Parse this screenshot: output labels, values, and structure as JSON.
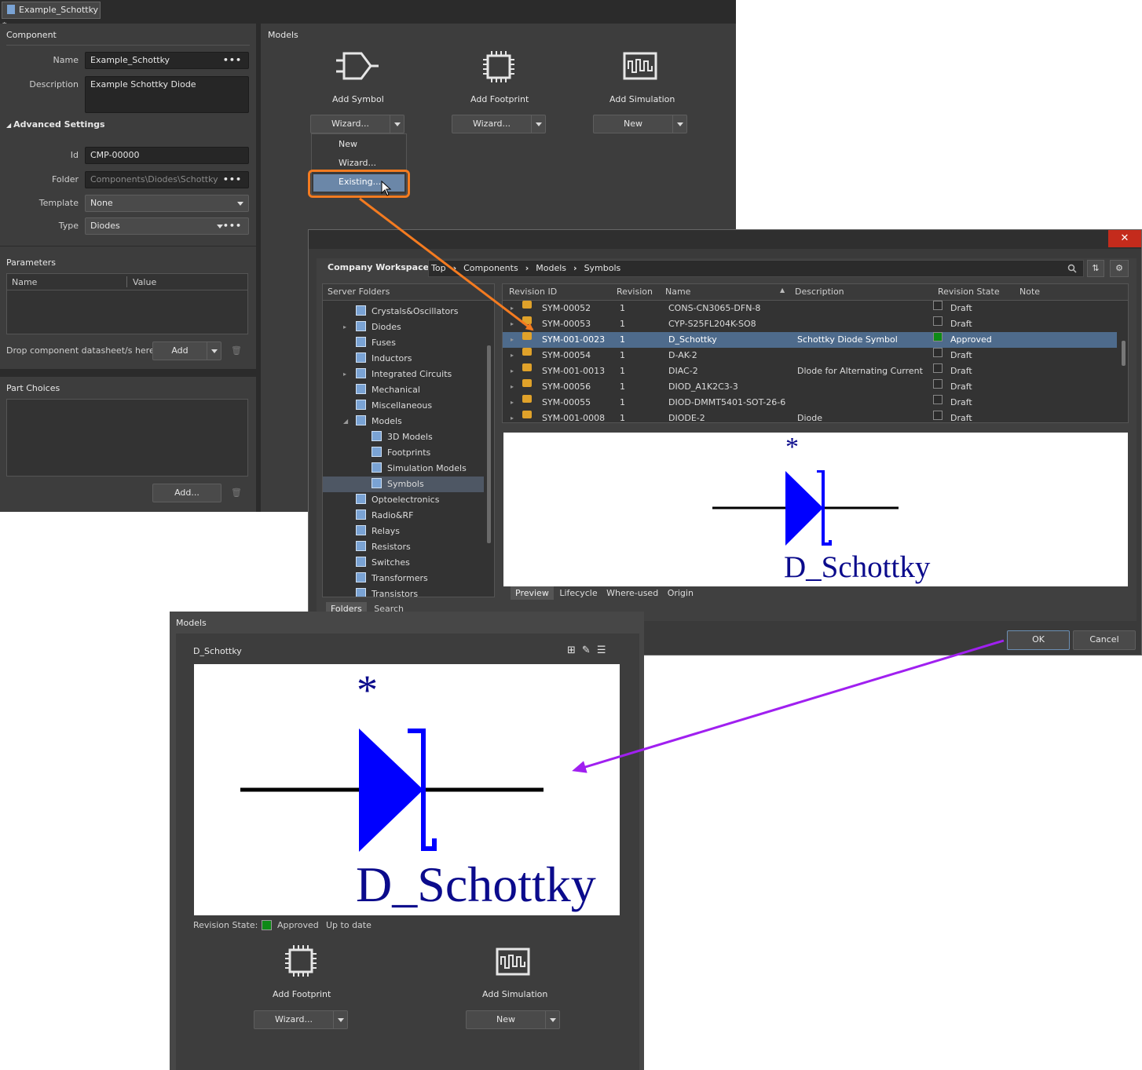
{
  "tab": {
    "title": "Example_Schottky *"
  },
  "component": {
    "section_title": "Component",
    "name_label": "Name",
    "name_value": "Example_Schottky",
    "description_label": "Description",
    "description_value": "Example Schottky Diode",
    "advanced_label": "Advanced Settings",
    "id_label": "Id",
    "id_value": "CMP-00000",
    "folder_label": "Folder",
    "folder_value": "Components\\Diodes\\Schottky",
    "template_label": "Template",
    "template_value": "None",
    "type_label": "Type",
    "type_value": "Diodes"
  },
  "parameters": {
    "section_title": "Parameters",
    "col_name": "Name",
    "col_value": "Value",
    "drop_text": "Drop component datasheet/s here",
    "add_label": "Add"
  },
  "part_choices": {
    "section_title": "Part Choices",
    "add_label": "Add..."
  },
  "models_top": {
    "section_title": "Models",
    "add_symbol": "Add Symbol",
    "add_footprint": "Add Footprint",
    "add_simulation": "Add Simulation",
    "symbol_btn": "Wizard...",
    "footprint_btn": "Wizard...",
    "simulation_btn": "New",
    "menu_items": [
      "New",
      "Wizard...",
      "Existing..."
    ]
  },
  "dialog": {
    "close_glyph": "✕",
    "workspace": "Company Workspace",
    "breadcrumb": [
      "Top",
      "Components",
      "Models",
      "Symbols"
    ],
    "folders_title": "Server Folders",
    "folders": [
      {
        "label": "Crystals&Oscillators",
        "level": 0,
        "expander": ""
      },
      {
        "label": "Diodes",
        "level": 0,
        "expander": "▸"
      },
      {
        "label": "Fuses",
        "level": 0,
        "expander": ""
      },
      {
        "label": "Inductors",
        "level": 0,
        "expander": ""
      },
      {
        "label": "Integrated Circuits",
        "level": 0,
        "expander": "▸"
      },
      {
        "label": "Mechanical",
        "level": 0,
        "expander": ""
      },
      {
        "label": "Miscellaneous",
        "level": 0,
        "expander": ""
      },
      {
        "label": "Models",
        "level": 0,
        "expander": "◢"
      },
      {
        "label": "3D Models",
        "level": 1,
        "expander": ""
      },
      {
        "label": "Footprints",
        "level": 1,
        "expander": ""
      },
      {
        "label": "Simulation Models",
        "level": 1,
        "expander": ""
      },
      {
        "label": "Symbols",
        "level": 1,
        "expander": ""
      },
      {
        "label": "Optoelectronics",
        "level": 0,
        "expander": ""
      },
      {
        "label": "Radio&RF",
        "level": 0,
        "expander": ""
      },
      {
        "label": "Relays",
        "level": 0,
        "expander": ""
      },
      {
        "label": "Resistors",
        "level": 0,
        "expander": ""
      },
      {
        "label": "Switches",
        "level": 0,
        "expander": ""
      },
      {
        "label": "Transformers",
        "level": 0,
        "expander": ""
      },
      {
        "label": "Transistors",
        "level": 0,
        "expander": ""
      }
    ],
    "folder_tabs": [
      "Folders",
      "Search"
    ],
    "columns": [
      "Revision ID",
      "Revision",
      "Name",
      "Description",
      "Revision State",
      "Note"
    ],
    "rows": [
      {
        "id": "SYM-00052",
        "rev": "1",
        "name": "CONS-CN3065-DFN-8",
        "desc": "",
        "state": "Draft",
        "color": ""
      },
      {
        "id": "SYM-00053",
        "rev": "1",
        "name": "CYP-S25FL204K-SO8",
        "desc": "",
        "state": "Draft",
        "color": ""
      },
      {
        "id": "SYM-001-0023",
        "rev": "1",
        "name": "D_Schottky",
        "desc": "Schottky Diode Symbol",
        "state": "Approved",
        "color": "#0e8a16"
      },
      {
        "id": "SYM-00054",
        "rev": "1",
        "name": "D-AK-2",
        "desc": "",
        "state": "Draft",
        "color": ""
      },
      {
        "id": "SYM-001-0013",
        "rev": "1",
        "name": "DIAC-2",
        "desc": "Dlode for Alternating Current",
        "state": "Draft",
        "color": ""
      },
      {
        "id": "SYM-00056",
        "rev": "1",
        "name": "DIOD_A1K2C3-3",
        "desc": "",
        "state": "Draft",
        "color": ""
      },
      {
        "id": "SYM-00055",
        "rev": "1",
        "name": "DIOD-DMMT5401-SOT-26-6",
        "desc": "",
        "state": "Draft",
        "color": ""
      },
      {
        "id": "SYM-001-0008",
        "rev": "1",
        "name": "DIODE-2",
        "desc": "Diode",
        "state": "Draft",
        "color": ""
      }
    ],
    "preview_tabs": [
      "Preview",
      "Lifecycle",
      "Where-used",
      "Origin"
    ],
    "ok_label": "OK",
    "cancel_label": "Cancel"
  },
  "symbol": {
    "asterisk": "*",
    "name": "D_Schottky"
  },
  "models_bottom": {
    "section_title": "Models",
    "model_name": "D_Schottky",
    "revision_state_label": "Revision State:",
    "revision_state_value": "Approved",
    "revision_status": "Up to date",
    "add_footprint": "Add Footprint",
    "add_simulation": "Add Simulation",
    "footprint_btn": "Wizard...",
    "simulation_btn": "New"
  },
  "colors": {
    "highlight": "#f47b20",
    "arrow2": "#a020f0",
    "symbol_blue": "#0000ff",
    "symbol_text": "#0b0b8c",
    "selection": "#4e6b8c"
  }
}
